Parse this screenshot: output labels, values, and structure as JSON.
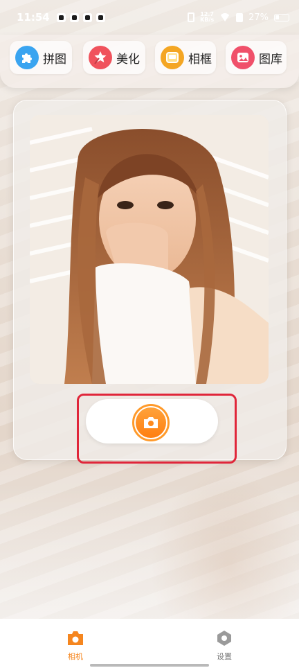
{
  "status_bar": {
    "time": "11:54",
    "net_speed_value": "12.7",
    "net_speed_unit": "KB/s",
    "battery": "27%",
    "icons": [
      "tiktok-icon",
      "app-icon",
      "sync-icon",
      "player-icon",
      "vibrate-icon",
      "wifi-icon",
      "sim-icon",
      "battery-icon"
    ]
  },
  "tools": [
    {
      "label": "拼图",
      "icon": "puzzle-icon",
      "color": "#3aa4f0"
    },
    {
      "label": "美化",
      "icon": "magic-star-icon",
      "color": "#f0525c"
    },
    {
      "label": "相框",
      "icon": "frame-icon",
      "color": "#f4a623"
    },
    {
      "label": "图库",
      "icon": "gallery-icon",
      "color": "#f0506a"
    }
  ],
  "shutter": {
    "icon": "camera-icon",
    "accent": "#ff8a1c",
    "highlight_color": "#e0263a"
  },
  "bottom_nav": {
    "items": [
      {
        "label": "相机",
        "icon": "camera-tab-icon",
        "color": "#f5861f",
        "active": true
      },
      {
        "label": "设置",
        "icon": "settings-hex-icon",
        "color": "#9a9a9a",
        "active": false
      }
    ]
  }
}
